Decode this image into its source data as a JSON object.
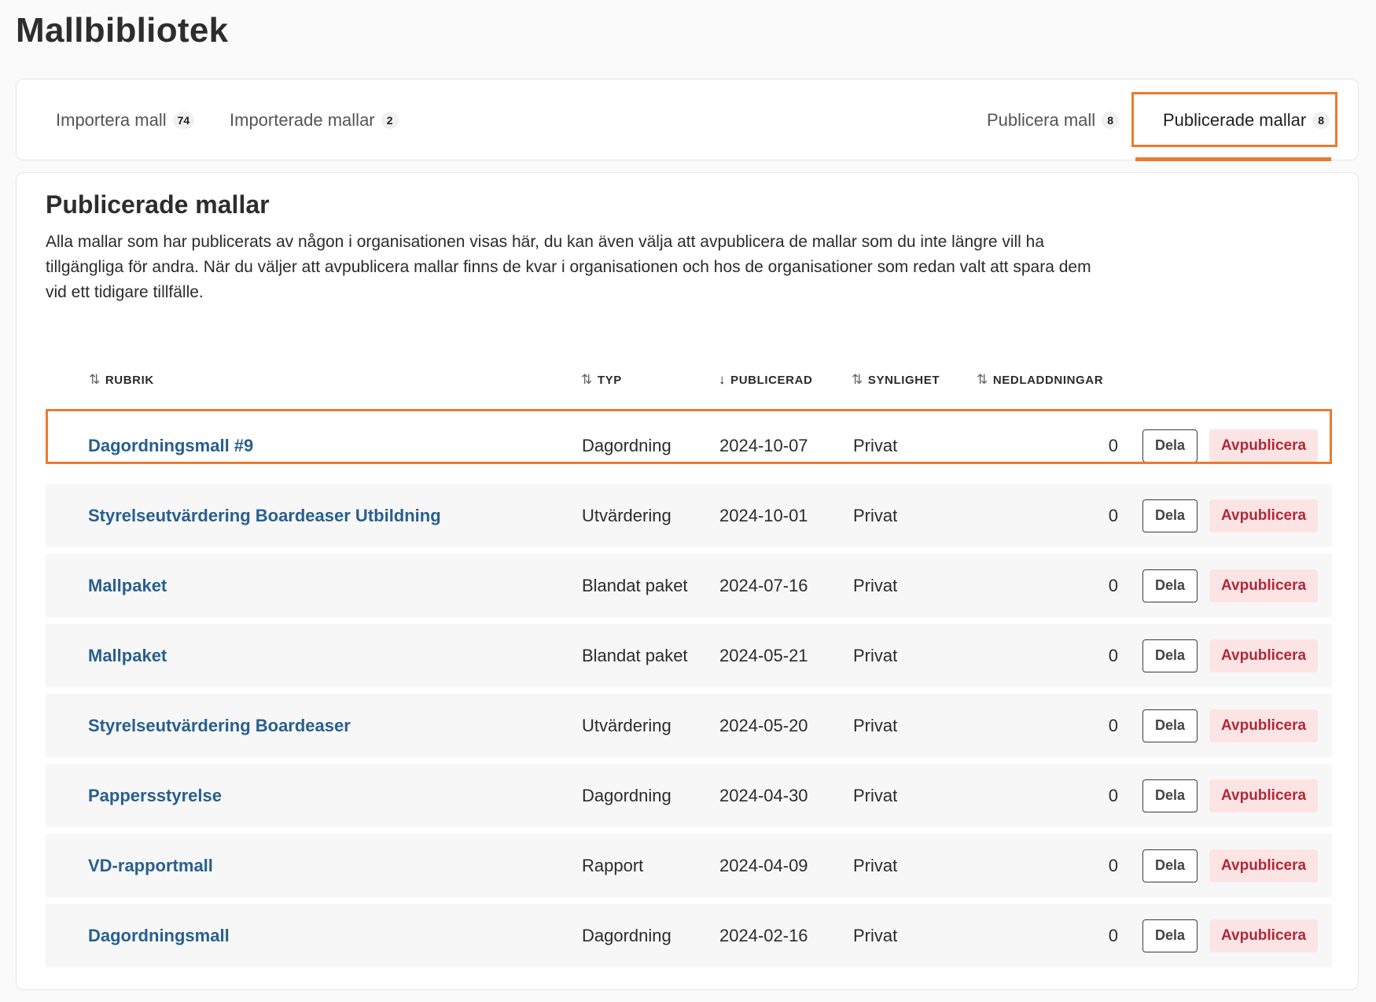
{
  "page": {
    "title": "Mallbibliotek"
  },
  "tabs": [
    {
      "label": "Importera mall",
      "count": "74",
      "active": false
    },
    {
      "label": "Importerade mallar",
      "count": "2",
      "active": false
    },
    {
      "label": "Publicera mall",
      "count": "8",
      "active": false
    },
    {
      "label": "Publicerade mallar",
      "count": "8",
      "active": true
    }
  ],
  "section": {
    "title": "Publicerade mallar",
    "description": "Alla mallar som har publicerats av någon i organisationen visas här, du kan även välja att avpublicera de mallar som du inte längre vill ha tillgängliga för andra. När du väljer att avpublicera mallar finns de kvar i organisationen och hos de organisationer som redan valt att spara dem vid ett tidigare tillfälle."
  },
  "table": {
    "columns": [
      {
        "label": "RUBRIK",
        "sort_icon": "sort-both-icon",
        "glyph": "⇅"
      },
      {
        "label": "TYP",
        "sort_icon": "sort-both-icon",
        "glyph": "⇅"
      },
      {
        "label": "PUBLICERAD",
        "sort_icon": "sort-desc-icon",
        "glyph": "↓"
      },
      {
        "label": "SYNLIGHET",
        "sort_icon": "sort-both-icon",
        "glyph": "⇅"
      },
      {
        "label": "NEDLADDNINGAR",
        "sort_icon": "sort-both-icon",
        "glyph": "⇅"
      }
    ],
    "share_label": "Dela",
    "unpublish_label": "Avpublicera",
    "rows": [
      {
        "title": "Dagordningsmall #9",
        "type": "Dagordning",
        "published": "2024-10-07",
        "visibility": "Privat",
        "downloads": "0"
      },
      {
        "title": "Styrelseutvärdering Boardeaser Utbildning",
        "type": "Utvärdering",
        "published": "2024-10-01",
        "visibility": "Privat",
        "downloads": "0"
      },
      {
        "title": "Mallpaket",
        "type": "Blandat paket",
        "published": "2024-07-16",
        "visibility": "Privat",
        "downloads": "0"
      },
      {
        "title": "Mallpaket",
        "type": "Blandat paket",
        "published": "2024-05-21",
        "visibility": "Privat",
        "downloads": "0"
      },
      {
        "title": "Styrelseutvärdering Boardeaser",
        "type": "Utvärdering",
        "published": "2024-05-20",
        "visibility": "Privat",
        "downloads": "0"
      },
      {
        "title": "Pappersstyrelse",
        "type": "Dagordning",
        "published": "2024-04-30",
        "visibility": "Privat",
        "downloads": "0"
      },
      {
        "title": "VD-rapportmall",
        "type": "Rapport",
        "published": "2024-04-09",
        "visibility": "Privat",
        "downloads": "0"
      },
      {
        "title": "Dagordningsmall",
        "type": "Dagordning",
        "published": "2024-02-16",
        "visibility": "Privat",
        "downloads": "0"
      }
    ]
  },
  "colors": {
    "accent_highlight": "#ec7a31",
    "link": "#285f8f",
    "danger": "#b0293a",
    "danger_bg": "#fde4e4"
  }
}
